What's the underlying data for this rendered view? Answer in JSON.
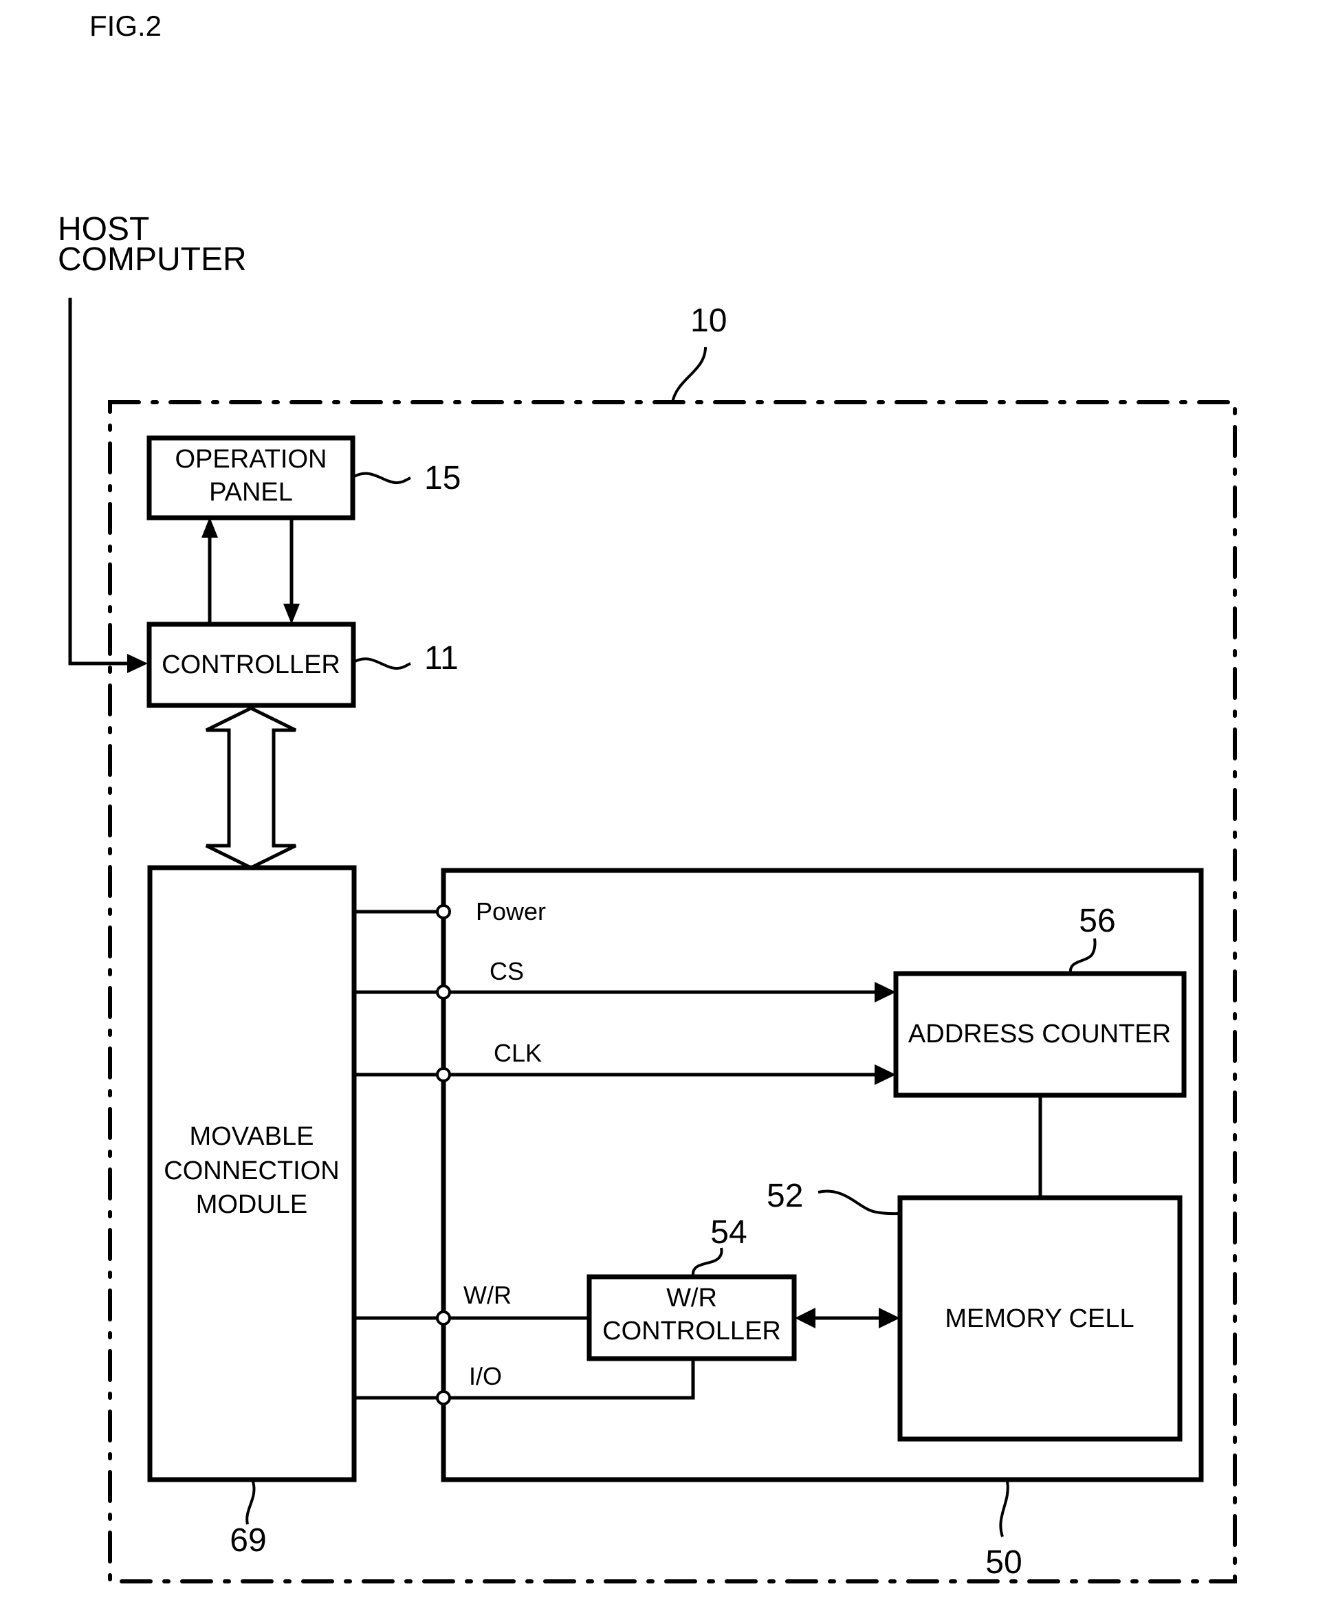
{
  "figure": {
    "title": "FIG.2",
    "external": {
      "line1": "HOST",
      "line2": "COMPUTER"
    },
    "outer_ref": "10",
    "blocks": {
      "operation_panel": {
        "line1": "OPERATION",
        "line2": "PANEL",
        "ref": "15"
      },
      "controller": {
        "label": "CONTROLLER",
        "ref": "11"
      },
      "movable_module": {
        "line1": "MOVABLE",
        "line2": "CONNECTION",
        "line3": "MODULE",
        "ref": "69"
      },
      "memory_unit": {
        "ref": "50"
      },
      "address_counter": {
        "label": "ADDRESS COUNTER",
        "ref": "56"
      },
      "memory_cell": {
        "label": "MEMORY CELL",
        "ref": "52"
      },
      "wr_controller": {
        "line1": "W/R",
        "line2": "CONTROLLER",
        "ref": "54"
      }
    },
    "signals": {
      "power": "Power",
      "cs": "CS",
      "clk": "CLK",
      "wr": "W/R",
      "io": "I/O"
    }
  }
}
